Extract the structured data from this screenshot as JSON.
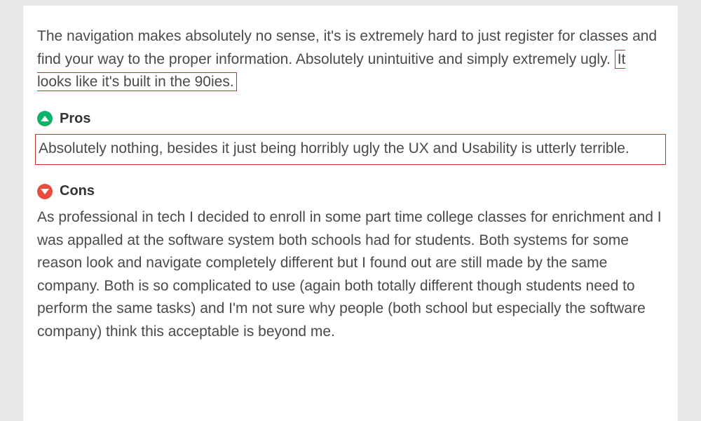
{
  "intro": {
    "part1": "The navigation makes absolutely no sense, it's is extremely hard to just register for classes and find your way to the proper information. Absolutely unintuitive and simply extremely ugly. ",
    "highlighted": "It looks like it's built in the 90ies."
  },
  "pros": {
    "heading": "Pros",
    "body": "Absolutely nothing, besides it just being horribly ugly the UX and Usability is utterly terrible."
  },
  "cons": {
    "heading": "Cons",
    "body": "As professional in tech I decided to enroll in some part time college classes for enrichment and I was appalled at the software system both schools had for students. Both systems for some reason look and navigate completely different but I found out are still made by the same company. Both is so complicated to use (again both totally different though students need to perform the same tasks) and I'm not sure why people (both school but especially the software company) think this acceptable is beyond me."
  }
}
